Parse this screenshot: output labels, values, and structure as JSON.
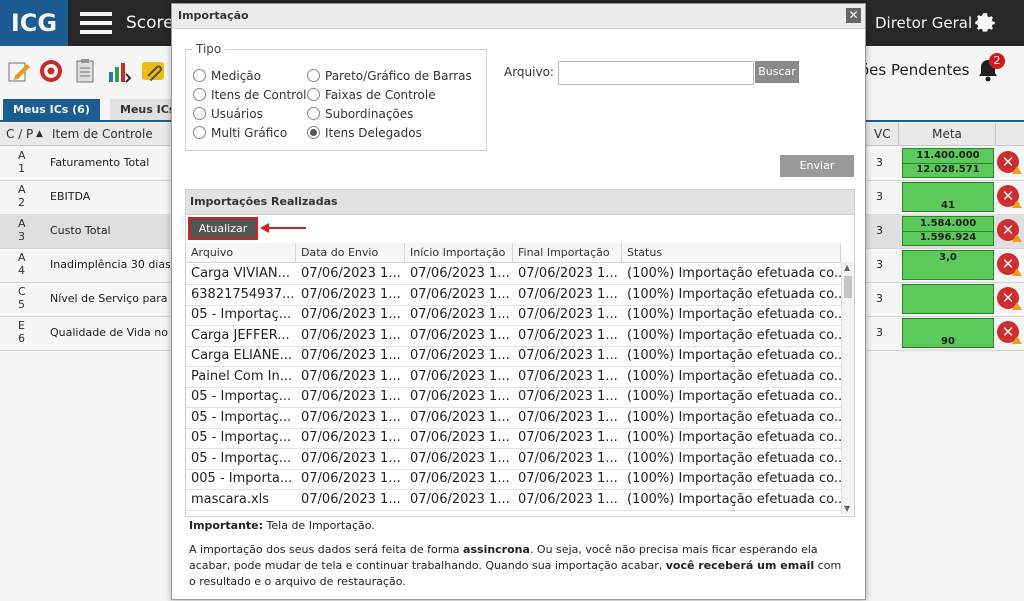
{
  "header": {
    "logo": "ICG",
    "app_title": "Score",
    "user": "Diretor Geral"
  },
  "toolbar": {
    "pending_label": "ões Pendentes",
    "bell_count": "2"
  },
  "tabs": [
    {
      "label": "Meus ICs (6)"
    },
    {
      "label": "Meus ICs A"
    }
  ],
  "grid": {
    "col_cp": "C / P",
    "col_item": "Item de Controle",
    "col_vc": "VC",
    "col_meta": "Meta",
    "rows": [
      {
        "c": "A",
        "p": "1",
        "name": "Faturamento Total",
        "vc": "3",
        "meta1": "11.400.000",
        "meta2": "12.028.571"
      },
      {
        "c": "A",
        "p": "2",
        "name": "EBITDA",
        "vc": "3",
        "meta1": "",
        "meta2": "41"
      },
      {
        "c": "A",
        "p": "3",
        "name": "Custo Total",
        "vc": "3",
        "meta1": "1.584.000",
        "meta2": "1.596.924"
      },
      {
        "c": "A",
        "p": "4",
        "name": "Inadimplência 30 dias",
        "vc": "3",
        "meta1": "3,0",
        "meta2": ""
      },
      {
        "c": "C",
        "p": "5",
        "name": "Nível de Serviço para o ...",
        "vc": "3",
        "meta1": "",
        "meta2": ""
      },
      {
        "c": "E",
        "p": "6",
        "name": "Qualidade de Vida no Tr...",
        "vc": "3",
        "meta1": "",
        "meta2": "90"
      }
    ]
  },
  "dialog": {
    "title": "Importação",
    "close": "✕",
    "tipo_label": "Tipo",
    "radios": [
      {
        "label": "Medição",
        "checked": false
      },
      {
        "label": "Itens de Controle",
        "checked": false
      },
      {
        "label": "Usuários",
        "checked": false
      },
      {
        "label": "Multi Gráfico",
        "checked": false
      },
      {
        "label": "Pareto/Gráfico de Barras",
        "checked": false
      },
      {
        "label": "Faixas de Controle",
        "checked": false
      },
      {
        "label": "Subordinações",
        "checked": false
      },
      {
        "label": "Itens Delegados",
        "checked": true
      }
    ],
    "arquivo_label": "Arquivo:",
    "arquivo_value": "",
    "buscar": "Buscar",
    "enviar": "Enviar",
    "panel_title": "Importações Realizadas",
    "atualizar": "Atualizar",
    "columns": [
      "Arquivo",
      "Data do Envio",
      "Início Importação",
      "Final Importação",
      "Status"
    ],
    "rows": [
      [
        "Carga VIVIAN...",
        "07/06/2023 1...",
        "07/06/2023 1...",
        "07/06/2023 1...",
        "(100%) Importação efetuada co..."
      ],
      [
        "63821754937...",
        "07/06/2023 1...",
        "07/06/2023 1...",
        "07/06/2023 1...",
        "(100%) Importação efetuada co..."
      ],
      [
        "05 - Importaç...",
        "07/06/2023 1...",
        "07/06/2023 1...",
        "07/06/2023 1...",
        "(100%) Importação efetuada co..."
      ],
      [
        "Carga JEFFER...",
        "07/06/2023 1...",
        "07/06/2023 1...",
        "07/06/2023 1...",
        "(100%) Importação efetuada co..."
      ],
      [
        "Carga ELIANE...",
        "07/06/2023 1...",
        "07/06/2023 1...",
        "07/06/2023 1...",
        "(100%) Importação efetuada co..."
      ],
      [
        "Painel Com In...",
        "07/06/2023 1...",
        "07/06/2023 1...",
        "07/06/2023 1...",
        "(100%) Importação efetuada co..."
      ],
      [
        "05 - Importaç...",
        "07/06/2023 1...",
        "07/06/2023 1...",
        "07/06/2023 1...",
        "(100%) Importação efetuada co..."
      ],
      [
        "05 - Importaç...",
        "07/06/2023 1...",
        "07/06/2023 1...",
        "07/06/2023 1...",
        "(100%) Importação efetuada co..."
      ],
      [
        "05 - Importaç...",
        "07/06/2023 1...",
        "07/06/2023 1...",
        "07/06/2023 1...",
        "(100%) Importação efetuada co..."
      ],
      [
        "05 - Importaç...",
        "07/06/2023 1...",
        "07/06/2023 1...",
        "07/06/2023 1...",
        "(100%) Importação efetuada co..."
      ],
      [
        "005 - Importa...",
        "07/06/2023 1...",
        "07/06/2023 1...",
        "07/06/2023 1...",
        "(100%) Importação efetuada co..."
      ],
      [
        "mascara.xls",
        "07/06/2023 1...",
        "07/06/2023 1...",
        "07/06/2023 1...",
        "(100%) Importação efetuada co..."
      ]
    ],
    "note_bold": "Importante:",
    "note_text": " Tela de Importação.",
    "para1": "A importação dos seus dados será feita de forma ",
    "para_bold1": "assincrona",
    "para2": ". Ou seja, você não precisa mais ficar esperando ela acabar, pode mudar de tela e continuar trabalhando. Quando sua importação acabar, ",
    "para_bold2": "você receberá um email",
    "para3": " com o resultado e o arquivo de restauração."
  },
  "colors": {
    "brand": "#1f5f9a",
    "meta_green": "#5fd35f",
    "highlight_red": "#d32020"
  }
}
